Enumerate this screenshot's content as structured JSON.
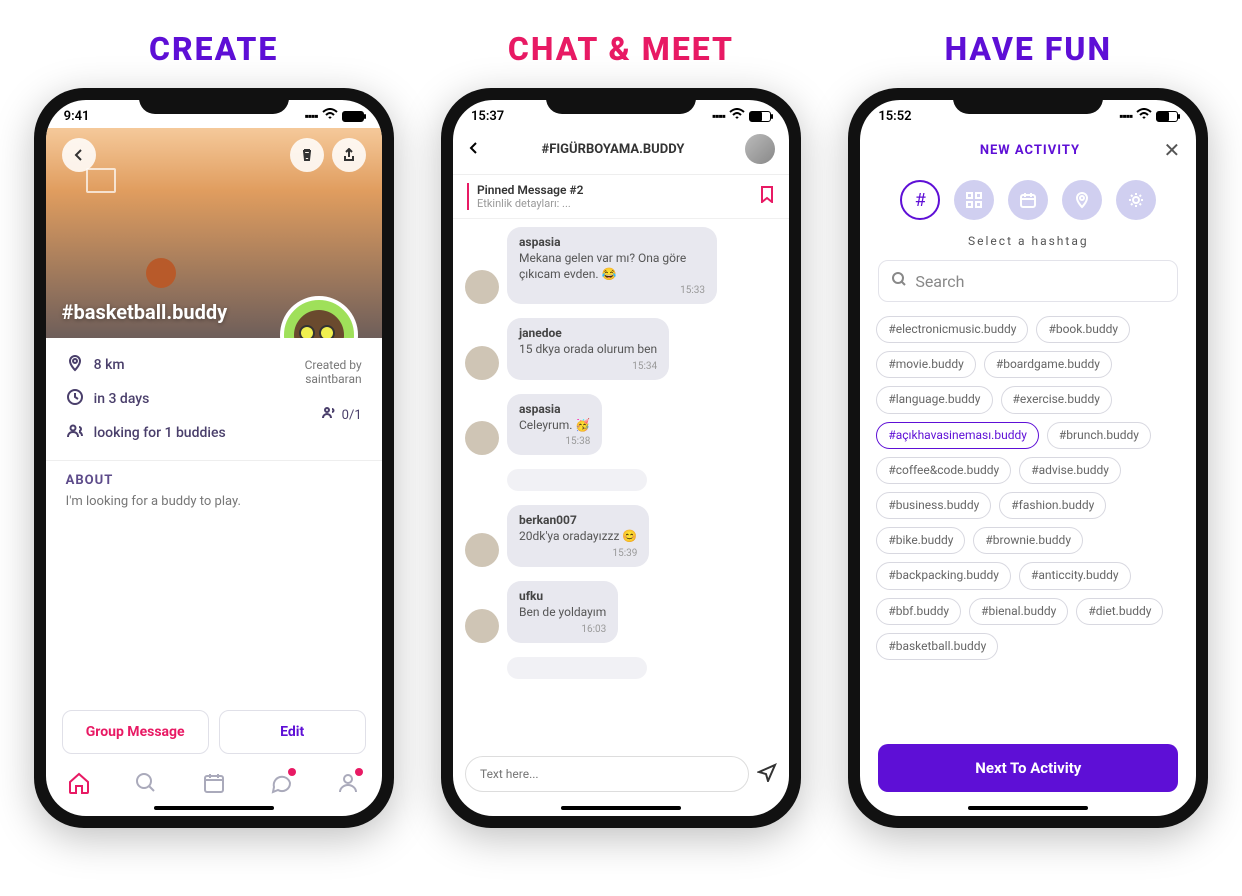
{
  "headings": [
    "CREATE",
    "CHAT & MEET",
    "HAVE FUN"
  ],
  "phone1": {
    "time": "9:41",
    "hashtag": "#basketball.buddy",
    "info": {
      "distance": "8 km",
      "when": "in 3 days",
      "looking": "looking for 1 buddies",
      "created_label": "Created by",
      "created_by": "saintbaran",
      "count": "0/1"
    },
    "about_heading": "ABOUT",
    "about_text": "I'm looking for a buddy to play.",
    "buttons": {
      "group": "Group Message",
      "edit": "Edit"
    }
  },
  "phone2": {
    "time": "15:37",
    "title": "#FIGÜRBOYAMA.BUDDY",
    "pinned": {
      "title": "Pinned Message #2",
      "sub": "Etkinlik detayları: ..."
    },
    "messages": [
      {
        "sender": "aspasia",
        "text": "Mekana gelen var mı? Ona göre çıkıcam evden. 😂",
        "time": "15:33"
      },
      {
        "sender": "janedoe",
        "text": "15 dkya orada olurum ben",
        "time": "15:34"
      },
      {
        "sender": "aspasia",
        "text": "Celeyrum. 🥳",
        "time": "15:38"
      },
      {
        "sender": "berkan007",
        "text": "20dk'ya oradayızzz 😊",
        "time": "15:39"
      },
      {
        "sender": "ufku",
        "text": "Ben de yoldayım",
        "time": "16:03"
      }
    ],
    "input_placeholder": "Text here..."
  },
  "phone3": {
    "time": "15:52",
    "title": "NEW ACTIVITY",
    "subhead": "Select a hashtag",
    "search_placeholder": "Search",
    "tags": [
      "#electronicmusic.buddy",
      "#book.buddy",
      "#movie.buddy",
      "#boardgame.buddy",
      "#language.buddy",
      "#exercise.buddy",
      "#açıkhavasineması.buddy",
      "#brunch.buddy",
      "#coffee&code.buddy",
      "#advise.buddy",
      "#business.buddy",
      "#fashion.buddy",
      "#bike.buddy",
      "#brownie.buddy",
      "#backpacking.buddy",
      "#anticcity.buddy",
      "#bbf.buddy",
      "#bienal.buddy",
      "#diet.buddy",
      "#basketball.buddy"
    ],
    "selected_tag": "#açıkhavasineması.buddy",
    "next_button": "Next To Activity"
  },
  "colors": {
    "purple": "#5E0FD6",
    "pink": "#E81A64",
    "bubble": "#E8E8EF"
  }
}
